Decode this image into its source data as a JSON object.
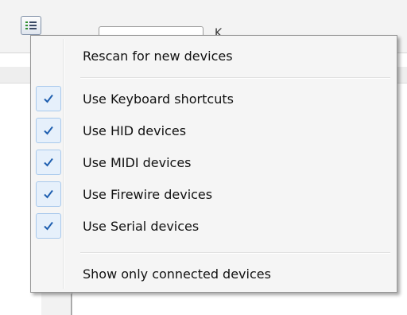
{
  "background": {
    "partial_label": "K"
  },
  "menu": {
    "top_items": [
      {
        "label": "Rescan for new devices"
      }
    ],
    "checked_items": [
      {
        "label": "Use Keyboard shortcuts",
        "checked": true
      },
      {
        "label": "Use HID devices",
        "checked": true
      },
      {
        "label": "Use MIDI devices",
        "checked": true
      },
      {
        "label": "Use Firewire devices",
        "checked": true
      },
      {
        "label": "Use Serial devices",
        "checked": true
      }
    ],
    "bottom_items": [
      {
        "label": "Show only connected devices"
      }
    ]
  },
  "colors": {
    "check": "#1f5fb0",
    "check_bg": "#e6f0fb",
    "check_border": "#a8c9ec"
  },
  "icons": {
    "app": "list-menu-icon",
    "check": "checkmark-icon"
  }
}
